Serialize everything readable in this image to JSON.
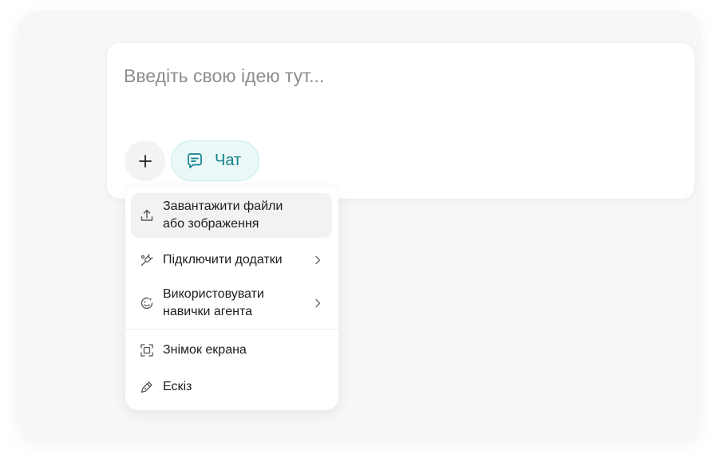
{
  "prompt": {
    "placeholder": "Введіть свою ідею тут...",
    "value": ""
  },
  "toolbar": {
    "add_icon": "plus-icon",
    "chat_chip": {
      "label": "Чат",
      "icon": "message-square-icon",
      "accent_color": "#12808a",
      "background_color": "#eaf8f8"
    }
  },
  "menu": {
    "items": [
      {
        "label": "Завантажити файли або зображення",
        "icon": "upload-icon",
        "has_submenu": false,
        "highlighted": true
      },
      {
        "label": "Підключити додатки",
        "icon": "plug-icon",
        "has_submenu": true,
        "highlighted": false
      },
      {
        "label": "Використовувати навички агента",
        "icon": "agent-skills-icon",
        "has_submenu": true,
        "highlighted": false
      },
      {
        "label": "Знімок екрана",
        "icon": "screenshot-icon",
        "has_submenu": false,
        "highlighted": false
      },
      {
        "label": "Ескіз",
        "icon": "pen-icon",
        "has_submenu": false,
        "highlighted": false
      }
    ]
  }
}
